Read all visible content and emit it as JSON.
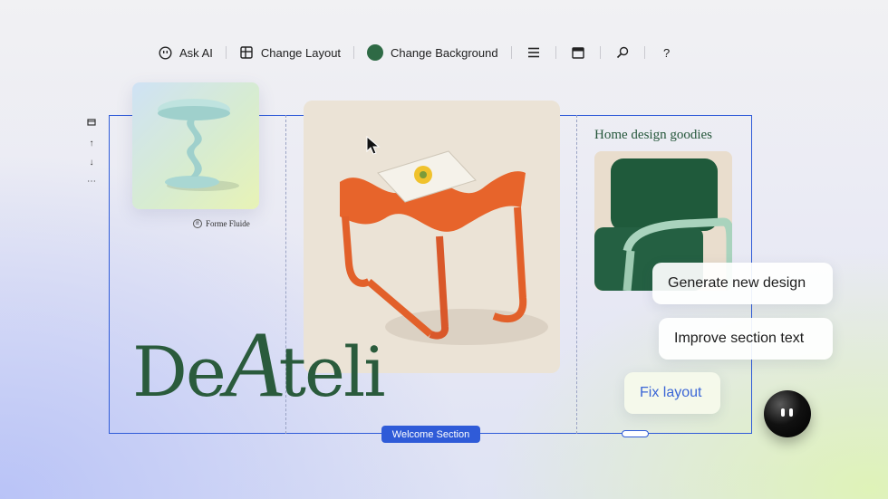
{
  "toolbar": {
    "ask_ai": "Ask AI",
    "change_layout": "Change Layout",
    "change_background": "Change Background",
    "background_color": "#2e6a45"
  },
  "canvas": {
    "brand_name": "Forme Fluide",
    "goodies_title": "Home design goodies",
    "logo_before": "De",
    "logo_script": "A",
    "logo_after": "teli",
    "section_label": "Welcome Section",
    "selection_color": "#2f5bd8"
  },
  "ai_actions": {
    "generate": "Generate new design",
    "improve": "Improve section text",
    "fix": "Fix layout"
  }
}
